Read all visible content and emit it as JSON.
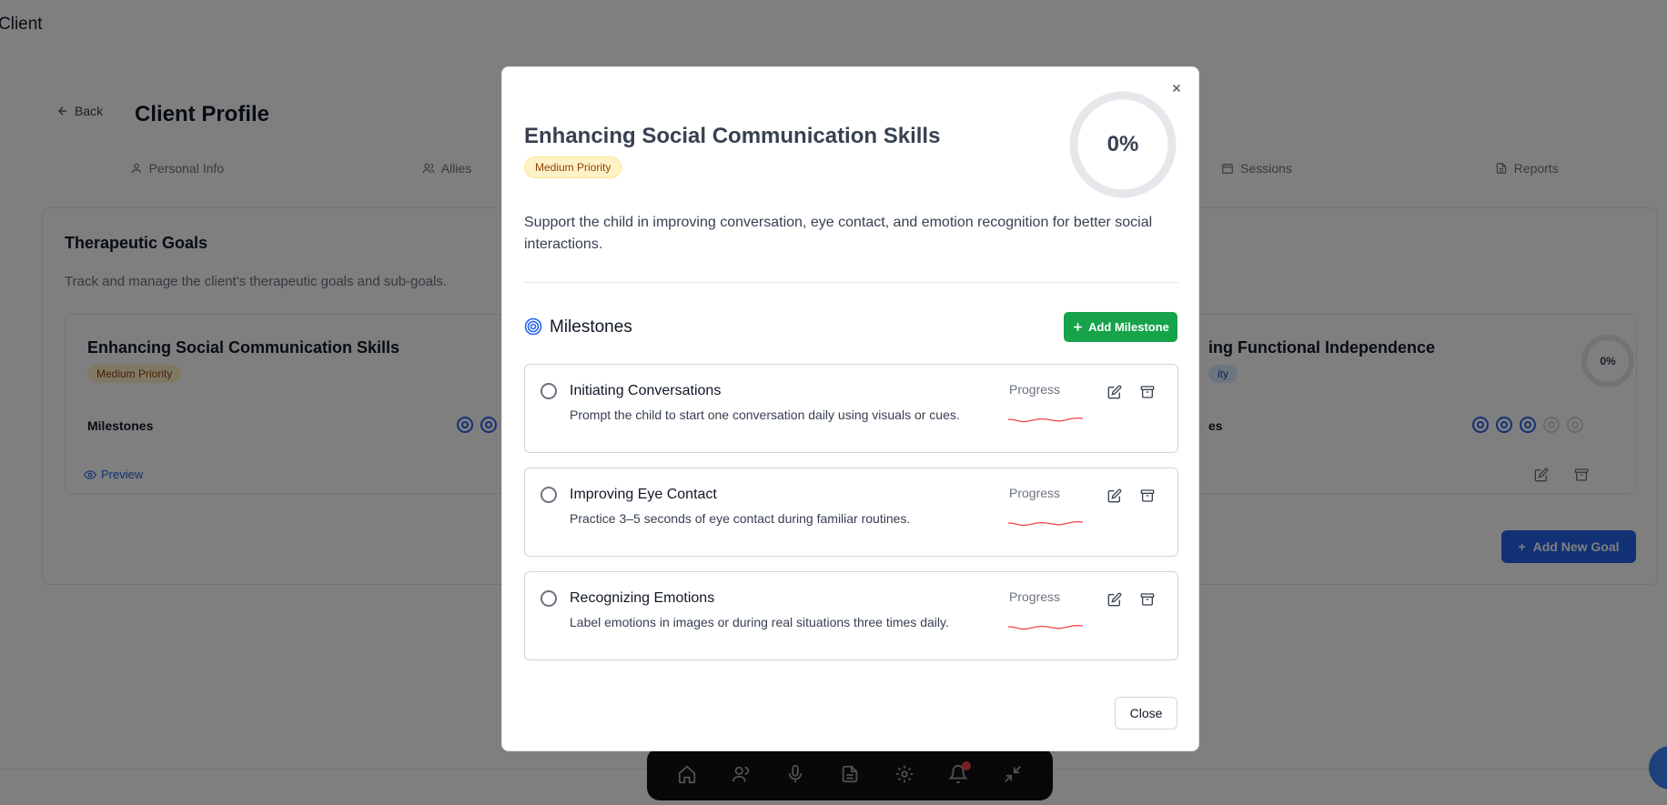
{
  "app": {
    "title": "Client"
  },
  "page": {
    "back_label": "Back",
    "title": "Client Profile",
    "tabs": [
      {
        "label": "Personal Info",
        "icon": "user-icon"
      },
      {
        "label": "Allies",
        "icon": "users-icon"
      },
      {
        "label": "",
        "icon": ""
      },
      {
        "label": "",
        "icon": ""
      },
      {
        "label": "Sessions",
        "icon": "calendar-icon"
      },
      {
        "label": "Reports",
        "icon": "file-icon"
      }
    ],
    "goals": {
      "title": "Therapeutic Goals",
      "subtitle": "Track and manage the client's therapeutic goals and sub-goals.",
      "cards": [
        {
          "name": "Enhancing Social Communication Skills",
          "priority": "Medium Priority",
          "milestones_label": "Milestones",
          "preview_label": "Preview"
        },
        {
          "name": "ing Functional Independence",
          "priority": "ity",
          "milestones_label": "es",
          "progress": "0%"
        }
      ],
      "add_goal_label": "Add New Goal"
    }
  },
  "modal": {
    "title": "Enhancing Social Communication Skills",
    "priority": "Medium Priority",
    "progress_percent": 0,
    "progress_label": "0%",
    "description": "Support the child in improving conversation, eye contact, and emotion recognition for better social interactions.",
    "milestones_heading": "Milestones",
    "add_milestone_label": "Add Milestone",
    "milestones": [
      {
        "title": "Initiating Conversations",
        "description": "Prompt the child to start one conversation daily using visuals or cues.",
        "progress_label": "Progress"
      },
      {
        "title": "Improving Eye Contact",
        "description": "Practice 3–5 seconds of eye contact during familiar routines.",
        "progress_label": "Progress"
      },
      {
        "title": "Recognizing Emotions",
        "description": "Label emotions in images or during real situations three times daily.",
        "progress_label": "Progress"
      }
    ],
    "close_label": "Close"
  },
  "colors": {
    "accent_green": "#16a34a",
    "accent_blue": "#2563eb",
    "priority_bg": "#fef3c7",
    "priority_text": "#92400e",
    "sparkline": "#ef4444"
  }
}
